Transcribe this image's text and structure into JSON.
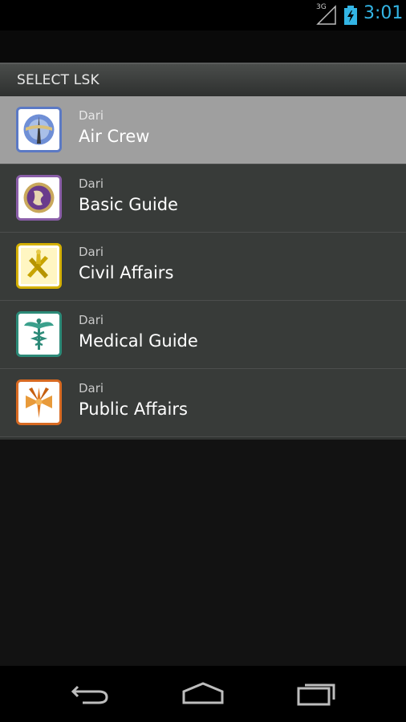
{
  "status_bar": {
    "network_type": "3G",
    "time": "3:01",
    "clock_color": "#33b5e5"
  },
  "dialog": {
    "title": "SELECT LSK",
    "items": [
      {
        "language": "Dari",
        "label": "Air Crew",
        "icon": "air-crew-emblem-icon",
        "selected": true
      },
      {
        "language": "Dari",
        "label": "Basic Guide",
        "icon": "basic-guide-emblem-icon",
        "selected": false
      },
      {
        "language": "Dari",
        "label": "Civil Affairs",
        "icon": "civil-affairs-emblem-icon",
        "selected": false
      },
      {
        "language": "Dari",
        "label": "Medical Guide",
        "icon": "medical-guide-caduceus-icon",
        "selected": false
      },
      {
        "language": "Dari",
        "label": "Public Affairs",
        "icon": "public-affairs-emblem-icon",
        "selected": false
      }
    ]
  },
  "nav_bar": {
    "back": "back-icon",
    "home": "home-icon",
    "recents": "recent-apps-icon"
  }
}
